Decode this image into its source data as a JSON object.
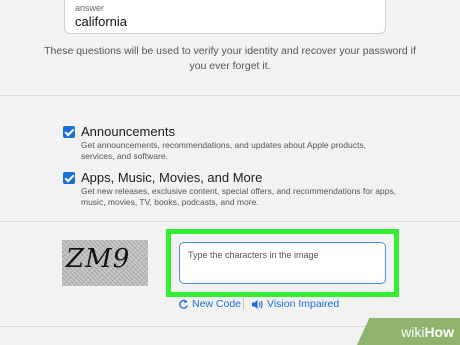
{
  "security_question": {
    "answer_label": "answer",
    "answer_value": "california",
    "helper_text": "These questions will be used to verify your identity and recover your password if you ever forget it."
  },
  "subscriptions": [
    {
      "title": "Announcements",
      "description": "Get announcements, recommendations, and updates about Apple products, services, and software.",
      "checked": true
    },
    {
      "title": "Apps, Music, Movies, and More",
      "description": "Get new releases, exclusive content, special offers, and recommendations for apps, music, movies, TV, books, podcasts, and more.",
      "checked": true
    }
  ],
  "captcha": {
    "image_text": "ZM9",
    "placeholder": "Type the characters in the image",
    "new_code_label": "New Code",
    "vision_impaired_label": "Vision Impaired"
  },
  "watermark": {
    "part1": "wiki",
    "part2": "How"
  },
  "colors": {
    "accent": "#1a6fd6",
    "highlight": "#33ee33",
    "watermark": "#8db36d"
  }
}
